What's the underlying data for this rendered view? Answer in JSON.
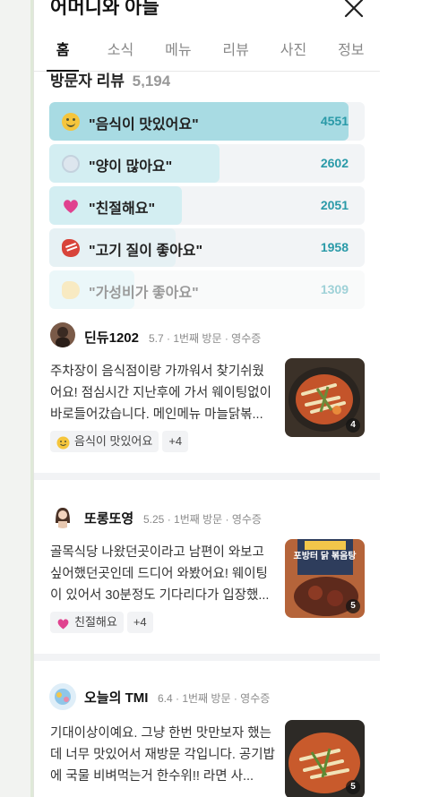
{
  "header": {
    "place_title": "어머니와 아들"
  },
  "tabs": [
    {
      "label": "홈",
      "active": true
    },
    {
      "label": "소식",
      "active": false
    },
    {
      "label": "메뉴",
      "active": false
    },
    {
      "label": "리뷰",
      "active": false
    },
    {
      "label": "사진",
      "active": false
    },
    {
      "label": "정보",
      "active": false
    }
  ],
  "visitor_reviews": {
    "heading": "방문자 리뷰",
    "count": "5,194"
  },
  "keywords": [
    {
      "emoji": "smile-emoji-icon",
      "text": "\"음식이 맛있어요\"",
      "count": 4551,
      "fill": 1.0
    },
    {
      "emoji": "bowl-emoji-icon",
      "text": "\"양이 많아요\"",
      "count": 2602,
      "fill": 0.57
    },
    {
      "emoji": "heart-emoji-icon",
      "text": "\"친절해요\"",
      "count": 2051,
      "fill": 0.45
    },
    {
      "emoji": "meat-emoji-icon",
      "text": "\"고기 질이 좋아요\"",
      "count": 1958,
      "fill": 0.43
    },
    {
      "emoji": "coin-emoji-icon",
      "text": "\"가성비가 좋아요\"",
      "count": 1309,
      "fill": 0.29
    }
  ],
  "reviews": [
    {
      "name": "딘듀1202",
      "meta": "5.7 · 1번째 방문 · 영수증",
      "body": "주차장이 음식점이랑 가까워서 찾기쉬웠어요! 점심시간 지난후에 가서 웨이팅없이 바로들어갔습니다. 메인메뉴 마늘닭볶...",
      "photo_count": "4",
      "tag_label": "음식이 맛있어요",
      "tag_emoji": "smile-emoji-icon",
      "extra_tags": "+4"
    },
    {
      "name": "또롱또영",
      "meta": "5.25 · 1번째 방문 · 영수증",
      "body": "골목식당 나왔던곳이라고 남편이 와보고 싶어했던곳인데 드디어 와봤어요! 웨이팅이 있어서 30분정도 기다리다가 입장했...",
      "photo_count": "5",
      "thumb_caption": "포방터 닭 볶음탕",
      "tag_label": "친절해요",
      "tag_emoji": "heart-emoji-icon",
      "extra_tags": "+4"
    },
    {
      "name": "오늘의 TMI",
      "meta": "6.4 · 1번째 방문 · 영수증",
      "body": "기대이상이예요. 그냥 한번 맛만보자 했는데 너무 맛있어서 재방문 각입니다. 공기밥에 국물 비벼먹는거 한수위!! 라면 사...",
      "photo_count": "5"
    }
  ],
  "colors": {
    "accent_count": "#2a9aa8",
    "top_bar": "#a8dbe3",
    "bar": "#d3eef2",
    "track": "#f2f4f6"
  }
}
